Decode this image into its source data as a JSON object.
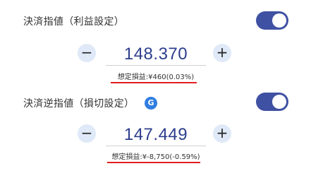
{
  "take_profit": {
    "label": "決済指値（利益設定）",
    "toggle_on": true,
    "minus": "−",
    "plus": "+",
    "price": "148.370",
    "estimated_profit": "想定損益:¥460(0.03%)"
  },
  "stop_loss": {
    "label": "決済逆指値（損切設定）",
    "badge": "G",
    "toggle_on": true,
    "minus": "−",
    "plus": "+",
    "price": "147.449",
    "estimated_profit": "想定損益:¥-8,750(-0.59%)"
  },
  "colors": {
    "accent": "#3f51a3",
    "stepper_bg": "#dfe9f7",
    "underline_red": "#e02020",
    "price": "#2c3e8c"
  }
}
